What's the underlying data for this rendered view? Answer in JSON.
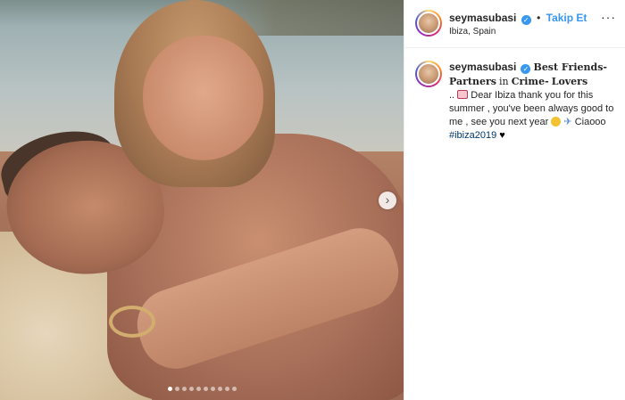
{
  "post": {
    "username": "seymasubasi",
    "verified_icon": "verified-badge-icon",
    "follow_label": "Takip Et",
    "separator": "•",
    "location": "Ibiza, Spain",
    "more_label": "···"
  },
  "caption": {
    "username": "seymasubasi",
    "part1": "Best Friends-",
    "part2": "Partners",
    "part3": "in",
    "part4": "Crime-",
    "part5": "Lovers",
    "lead": "..",
    "text1": "Dear Ibiza thank you for this summer , you've been always good to me , see you next year",
    "text2": "Ciaooo",
    "hashtag": "#ibiza2019",
    "emoji_letter": "love-letter-icon",
    "emoji_face": "smiling-face-icon",
    "emoji_plane": "airplane-icon",
    "emoji_heart": "black-heart-icon"
  },
  "media": {
    "next_label": "›",
    "slide_count": 10,
    "active_slide": 1
  },
  "colors": {
    "link_blue": "#3897f0",
    "hashtag": "#00376b",
    "text": "#262626"
  }
}
